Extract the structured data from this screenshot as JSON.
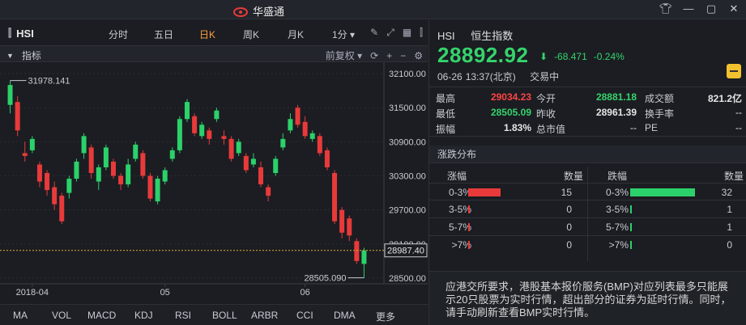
{
  "window": {
    "title": "华盛通",
    "controls": [
      "shirt-icon",
      "minimize-icon",
      "maximize-icon",
      "close-icon"
    ]
  },
  "toolbar": {
    "symbol": "HSI",
    "timeframes": [
      "分时",
      "五日",
      "日K",
      "周K",
      "月K",
      "1分"
    ],
    "active_timeframe": "日K"
  },
  "subbar": {
    "indicator_label": "指标",
    "adjust_label": "前复权"
  },
  "chart": {
    "y_ticks": [
      "32100.00",
      "31500.00",
      "30900.00",
      "30300.00",
      "29700.00",
      "29100.00",
      "28500.00"
    ],
    "x_ticks": [
      "2018-04",
      "05",
      "06"
    ],
    "current_price_label": "28987.40",
    "high_annotation": "31978.141",
    "low_annotation": "28505.090",
    "colors": {
      "up": "#2bd16a",
      "down": "#e83a3a"
    }
  },
  "chart_data": {
    "type": "candlestick",
    "title": "",
    "ylim": [
      28400,
      32300
    ],
    "x_labels": [
      "2018-04",
      "05",
      "06"
    ],
    "current_price": 28987.4,
    "max_high": 31978.141,
    "min_low": 28505.09,
    "candles": [
      {
        "o": 31550,
        "c": 31900,
        "h": 31978,
        "l": 31400
      },
      {
        "o": 31600,
        "c": 31100,
        "h": 31700,
        "l": 31000
      },
      {
        "o": 30700,
        "c": 30650,
        "h": 30900,
        "l": 30550
      },
      {
        "o": 30750,
        "c": 30950,
        "h": 31000,
        "l": 30700
      },
      {
        "o": 30500,
        "c": 30200,
        "h": 30550,
        "l": 30100
      },
      {
        "o": 30350,
        "c": 30050,
        "h": 30400,
        "l": 29950
      },
      {
        "o": 30100,
        "c": 29800,
        "h": 30200,
        "l": 29700
      },
      {
        "o": 29950,
        "c": 29500,
        "h": 30000,
        "l": 29450
      },
      {
        "o": 30000,
        "c": 30250,
        "h": 30300,
        "l": 29900
      },
      {
        "o": 30250,
        "c": 30550,
        "h": 30600,
        "l": 30200
      },
      {
        "o": 30700,
        "c": 31000,
        "h": 31050,
        "l": 30600
      },
      {
        "o": 30800,
        "c": 30350,
        "h": 30850,
        "l": 30250
      },
      {
        "o": 30200,
        "c": 30450,
        "h": 30500,
        "l": 30050
      },
      {
        "o": 30450,
        "c": 30800,
        "h": 30850,
        "l": 30400
      },
      {
        "o": 30550,
        "c": 30300,
        "h": 30600,
        "l": 30250
      },
      {
        "o": 30300,
        "c": 30150,
        "h": 30350,
        "l": 30050
      },
      {
        "o": 30150,
        "c": 30500,
        "h": 30600,
        "l": 30100
      },
      {
        "o": 30600,
        "c": 30850,
        "h": 30900,
        "l": 30550
      },
      {
        "o": 30700,
        "c": 30300,
        "h": 30750,
        "l": 30250
      },
      {
        "o": 30300,
        "c": 29900,
        "h": 30350,
        "l": 29850
      },
      {
        "o": 29850,
        "c": 30250,
        "h": 30300,
        "l": 29800
      },
      {
        "o": 30200,
        "c": 30400,
        "h": 30450,
        "l": 30150
      },
      {
        "o": 30600,
        "c": 30750,
        "h": 30800,
        "l": 30550
      },
      {
        "o": 30750,
        "c": 31300,
        "h": 31350,
        "l": 30700
      },
      {
        "o": 31300,
        "c": 31600,
        "h": 31650,
        "l": 31250
      },
      {
        "o": 31350,
        "c": 31050,
        "h": 31400,
        "l": 31000
      },
      {
        "o": 31000,
        "c": 31200,
        "h": 31250,
        "l": 30950
      },
      {
        "o": 31100,
        "c": 30950,
        "h": 31150,
        "l": 30850
      },
      {
        "o": 31300,
        "c": 31450,
        "h": 31500,
        "l": 31250
      },
      {
        "o": 31000,
        "c": 30950,
        "h": 31100,
        "l": 30850
      },
      {
        "o": 30950,
        "c": 30600,
        "h": 31000,
        "l": 30550
      },
      {
        "o": 30700,
        "c": 30900,
        "h": 30950,
        "l": 30650
      },
      {
        "o": 30650,
        "c": 30400,
        "h": 30700,
        "l": 30350
      },
      {
        "o": 30500,
        "c": 30600,
        "h": 30700,
        "l": 30450
      },
      {
        "o": 30450,
        "c": 30150,
        "h": 30550,
        "l": 30100
      },
      {
        "o": 30100,
        "c": 29950,
        "h": 30150,
        "l": 29850
      },
      {
        "o": 30350,
        "c": 30600,
        "h": 30650,
        "l": 30300
      },
      {
        "o": 30800,
        "c": 30950,
        "h": 31050,
        "l": 30750
      },
      {
        "o": 31100,
        "c": 31300,
        "h": 31400,
        "l": 31050
      },
      {
        "o": 31500,
        "c": 31200,
        "h": 31550,
        "l": 31150
      },
      {
        "o": 31250,
        "c": 31000,
        "h": 31350,
        "l": 30950
      },
      {
        "o": 30950,
        "c": 31050,
        "h": 31100,
        "l": 30900
      },
      {
        "o": 31000,
        "c": 30700,
        "h": 31050,
        "l": 30650
      },
      {
        "o": 30750,
        "c": 30450,
        "h": 30800,
        "l": 30400
      },
      {
        "o": 30350,
        "c": 29500,
        "h": 30400,
        "l": 29450
      },
      {
        "o": 29700,
        "c": 29300,
        "h": 29750,
        "l": 29200
      },
      {
        "o": 29550,
        "c": 29250,
        "h": 29600,
        "l": 29150
      },
      {
        "o": 29150,
        "c": 28800,
        "h": 29200,
        "l": 28750
      },
      {
        "o": 28750,
        "c": 28987,
        "h": 29034,
        "l": 28505
      }
    ]
  },
  "indicator_bar": [
    "MA",
    "VOL",
    "MACD",
    "KDJ",
    "RSI",
    "BOLL",
    "ARBR",
    "CCI",
    "DMA",
    "更多"
  ],
  "quote": {
    "code": "HSI",
    "name": "恒生指数",
    "price": "28892.92",
    "change": "-68.471",
    "change_pct": "-0.24%",
    "date": "06-26",
    "time": "13:37(北京)",
    "status": "交易中",
    "high_label": "最高",
    "high": "29034.23",
    "low_label": "最低",
    "low": "28505.09",
    "amp_label": "振幅",
    "amp": "1.83%",
    "open_label": "今开",
    "open": "28881.18",
    "prev_label": "昨收",
    "prev": "28961.39",
    "mcap_label": "总市值",
    "mcap": "--",
    "turnover_label": "成交额",
    "turnover": "821.2亿",
    "turnrate_label": "换手率",
    "turnrate": "--",
    "pe_label": "PE",
    "pe": "--"
  },
  "distribution": {
    "title": "涨跌分布",
    "up_header": "涨幅",
    "down_header": "跌幅",
    "count_header": "数量",
    "rows": [
      {
        "up_range": "0-3%",
        "up_count": "15",
        "up_frac": 0.47,
        "down_range": "0-3%",
        "down_count": "32",
        "down_frac": 1.0
      },
      {
        "up_range": "3-5%",
        "up_count": "0",
        "up_frac": 0,
        "down_range": "3-5%",
        "down_count": "1",
        "down_frac": 0.03
      },
      {
        "up_range": "5-7%",
        "up_count": "0",
        "up_frac": 0,
        "down_range": "5-7%",
        "down_count": "1",
        "down_frac": 0.03
      },
      {
        "up_range": ">7%",
        "up_count": "0",
        "up_frac": 0,
        "down_range": ">7%",
        "down_count": "0",
        "down_frac": 0
      }
    ]
  },
  "notice": "应港交所要求，港股基本报价服务(BMP)对应列表最多只能展示20只股票为实时行情，超出部分的证券为延时行情。同时，请手动刷新查看BMP实时行情。"
}
